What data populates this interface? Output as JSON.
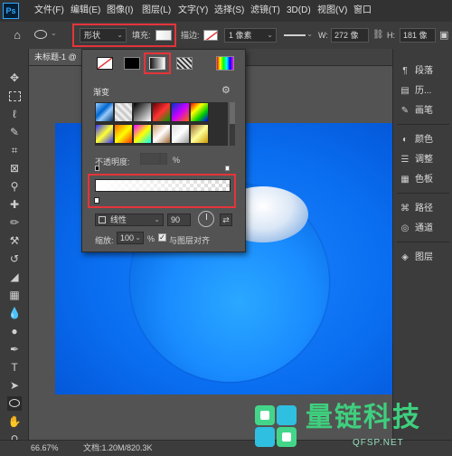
{
  "app": {
    "logo": "Ps"
  },
  "menu": [
    "文件(F)",
    "编辑(E)",
    "图像(I)",
    "图层(L)",
    "文字(Y)",
    "选择(S)",
    "滤镜(T)",
    "3D(D)",
    "视图(V)",
    "窗口"
  ],
  "options": {
    "mode_value": "形状",
    "fill_label": "填充:",
    "stroke_label": "描边:",
    "stroke_width": "1 像素",
    "w_label": "W:",
    "w_value": "272 像",
    "h_label": "H:",
    "h_value": "181 像"
  },
  "document": {
    "tab_label": "未标题-1 @"
  },
  "fill_popup": {
    "section_label": "渐变",
    "opacity_label": "不透明度:",
    "opacity_unit": "%",
    "style_value": "线性",
    "angle_value": "90",
    "scale_label": "缩放:",
    "scale_value": "100",
    "scale_unit": "%",
    "align_label": "与图层对齐"
  },
  "panels": [
    {
      "icon": "paragraph-icon",
      "label": "段落"
    },
    {
      "icon": "history-icon",
      "label": "历..."
    },
    {
      "icon": "brush-icon",
      "label": "画笔"
    },
    {
      "icon": "color-icon",
      "label": "颜色"
    },
    {
      "icon": "adjust-icon",
      "label": "调整"
    },
    {
      "icon": "swatches-icon",
      "label": "色板"
    },
    {
      "icon": "paths-icon",
      "label": "路径"
    },
    {
      "icon": "channels-icon",
      "label": "通道"
    },
    {
      "icon": "layers-icon",
      "label": "图层"
    }
  ],
  "status": {
    "zoom": "66.67%",
    "doc_info": "文档:1.20M/820.3K"
  },
  "watermark": {
    "brand": "量链科技",
    "domain": "QFSP.NET"
  },
  "colors": {
    "highlight_frame": "#e5343b",
    "canvas_blue": "#0a6ef0",
    "watermark_green": "#3fcf7e"
  }
}
